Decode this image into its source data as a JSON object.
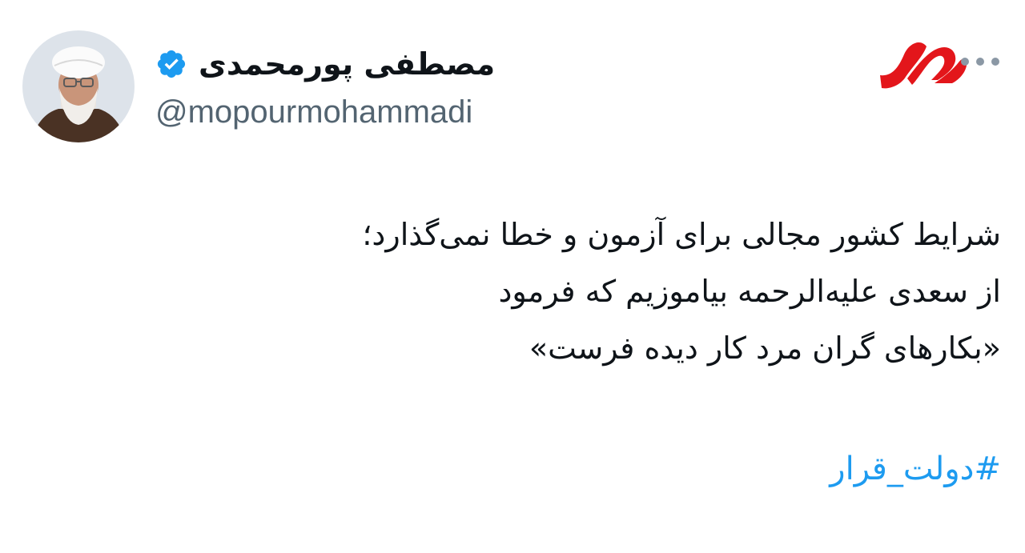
{
  "author": {
    "display_name": "مصطفی پورمحمدی",
    "handle": "@mopourmohammadi",
    "verified": true
  },
  "publisher_logo": "mehr-news-logo",
  "tweet": {
    "lines": [
      "شرایط کشور مجالی برای آزمون و خطا نمی‌گذارد؛",
      "از سعدی علیه‌الرحمه بیاموزیم که فرمود",
      "«بکارهای گران مرد کار دیده فرست»"
    ],
    "hashtag": "#دولت_قرار"
  },
  "colors": {
    "text": "#0f1419",
    "secondary": "#536471",
    "link": "#1d9bf0",
    "verified": "#1d9bf0",
    "logo": "#e3161b"
  },
  "icons": {
    "more": "more-horizontal-icon",
    "verified": "verified-badge-icon"
  }
}
